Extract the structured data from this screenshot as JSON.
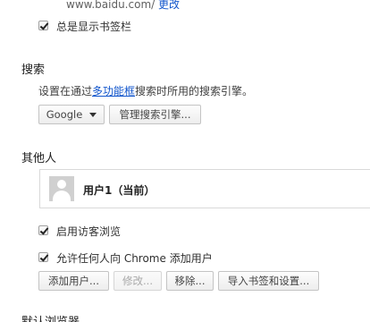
{
  "homepage": {
    "url_text": "www.baidu.com/",
    "change_link": "更改"
  },
  "bookmarks_bar": {
    "checkbox_label": "总是显示书签栏",
    "checked": true
  },
  "search": {
    "section_title": "搜索",
    "description_prefix": "设置在通过",
    "omnibox_link": "多功能框",
    "description_suffix": "搜索时所用的搜索引擎。",
    "engine_selected": "Google",
    "manage_button": "管理搜索引擎..."
  },
  "people": {
    "section_title": "其他人",
    "users": [
      {
        "name": "用户1（当前）"
      }
    ],
    "guest_label": "启用访客浏览",
    "guest_checked": true,
    "anyone_add_label": "允许任何人向 Chrome 添加用户",
    "anyone_add_checked": true,
    "buttons": {
      "add": "添加用户...",
      "edit": "修改...",
      "remove": "移除...",
      "import": "导入书签和设置..."
    }
  },
  "default_browser": {
    "section_title": "默认浏览器"
  }
}
